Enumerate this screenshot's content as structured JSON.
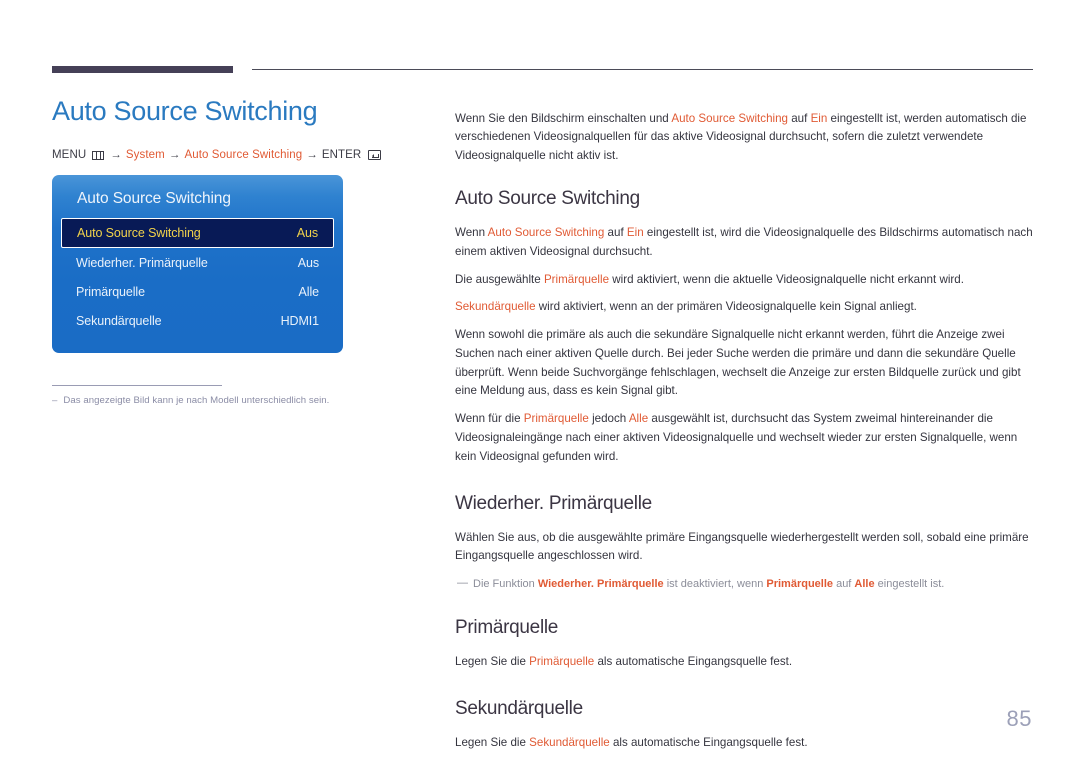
{
  "document": {
    "page_number": "85",
    "left_title": "Auto Source Switching",
    "menu_path": {
      "menu_label": "MENU",
      "menu_icon": "menu-grid-icon",
      "arrow": "→",
      "step1": "System",
      "step2": "Auto Source Switching",
      "enter_label": "ENTER",
      "enter_icon": "enter-key-icon"
    },
    "osd": {
      "title": "Auto Source Switching",
      "rows": [
        {
          "label": "Auto Source Switching",
          "value": "Aus",
          "selected": true
        },
        {
          "label": "Wiederher. Primärquelle",
          "value": "Aus",
          "selected": false
        },
        {
          "label": "Primärquelle",
          "value": "Alle",
          "selected": false
        },
        {
          "label": "Sekundärquelle",
          "value": "HDMI1",
          "selected": false
        }
      ]
    },
    "left_footnote": {
      "dash": "–",
      "text": "Das angezeigte Bild kann je nach Modell unterschiedlich sein."
    },
    "intro": {
      "p1_a": "Wenn Sie den Bildschirm einschalten und ",
      "p1_k1": "Auto Source Switching",
      "p1_b": " auf ",
      "p1_k2": "Ein",
      "p1_c": " eingestellt ist, werden automatisch die verschiedenen Videosignalquellen für das aktive Videosignal durchsucht, sofern die zuletzt verwendete Videosignalquelle nicht aktiv ist."
    },
    "sections": [
      {
        "heading": "Auto Source Switching",
        "paragraphs": [
          {
            "parts": [
              {
                "t": "Wenn ",
                "k": false
              },
              {
                "t": "Auto Source Switching",
                "k": true
              },
              {
                "t": " auf ",
                "k": false
              },
              {
                "t": "Ein",
                "k": true
              },
              {
                "t": " eingestellt ist, wird die Videosignalquelle des Bildschirms automatisch nach einem aktiven Videosignal durchsucht.",
                "k": false
              }
            ]
          },
          {
            "parts": [
              {
                "t": "Die ausgewählte ",
                "k": false
              },
              {
                "t": "Primärquelle",
                "k": true
              },
              {
                "t": " wird aktiviert, wenn die aktuelle Videosignalquelle nicht erkannt wird.",
                "k": false
              }
            ]
          },
          {
            "parts": [
              {
                "t": "Sekundärquelle",
                "k": true
              },
              {
                "t": " wird aktiviert, wenn an der primären Videosignalquelle kein Signal anliegt.",
                "k": false
              }
            ]
          },
          {
            "parts": [
              {
                "t": "Wenn sowohl die primäre als auch die sekundäre Signalquelle nicht erkannt werden, führt die Anzeige zwei Suchen nach einer aktiven Quelle durch. Bei jeder Suche werden die primäre und dann die sekundäre Quelle überprüft. Wenn beide Suchvorgänge fehlschlagen, wechselt die Anzeige zur ersten Bildquelle zurück und gibt eine Meldung aus, dass es kein Signal gibt.",
                "k": false
              }
            ]
          },
          {
            "parts": [
              {
                "t": "Wenn für die ",
                "k": false
              },
              {
                "t": "Primärquelle",
                "k": true
              },
              {
                "t": " jedoch ",
                "k": false
              },
              {
                "t": "Alle",
                "k": true
              },
              {
                "t": " ausgewählt ist, durchsucht das System zweimal hintereinander die Videosignaleingänge nach einer aktiven Videosignalquelle und wechselt wieder zur ersten Signalquelle, wenn kein Videosignal gefunden wird.",
                "k": false
              }
            ]
          }
        ],
        "note": null
      },
      {
        "heading": "Wiederher. Primärquelle",
        "paragraphs": [
          {
            "parts": [
              {
                "t": "Wählen Sie aus, ob die ausgewählte primäre Eingangsquelle wiederhergestellt werden soll, sobald eine primäre Eingangsquelle angeschlossen wird.",
                "k": false
              }
            ]
          }
        ],
        "note": {
          "dash": "—",
          "parts": [
            {
              "t": "Die Funktion ",
              "k": false
            },
            {
              "t": "Wiederher. Primärquelle",
              "k": true
            },
            {
              "t": " ist deaktiviert, wenn ",
              "k": false
            },
            {
              "t": "Primärquelle",
              "k": true
            },
            {
              "t": " auf ",
              "k": false
            },
            {
              "t": "Alle",
              "k": true
            },
            {
              "t": " eingestellt ist.",
              "k": false
            }
          ]
        }
      },
      {
        "heading": "Primärquelle",
        "paragraphs": [
          {
            "parts": [
              {
                "t": "Legen Sie die ",
                "k": false
              },
              {
                "t": "Primärquelle",
                "k": true
              },
              {
                "t": " als automatische Eingangsquelle fest.",
                "k": false
              }
            ]
          }
        ],
        "note": null
      },
      {
        "heading": "Sekundärquelle",
        "paragraphs": [
          {
            "parts": [
              {
                "t": "Legen Sie die ",
                "k": false
              },
              {
                "t": "Sekundärquelle",
                "k": true
              },
              {
                "t": " als automatische Eingangsquelle fest.",
                "k": false
              }
            ]
          }
        ],
        "note": null
      }
    ],
    "colors": {
      "title_blue": "#2a7ac0",
      "accent_orange": "#e05a34",
      "heading_dark": "#3b3543",
      "osd_blue": "#1a6cc5",
      "osd_selected_bg": "#081a56",
      "osd_selected_text": "#f2d34b",
      "muted": "#8b8da6"
    }
  }
}
